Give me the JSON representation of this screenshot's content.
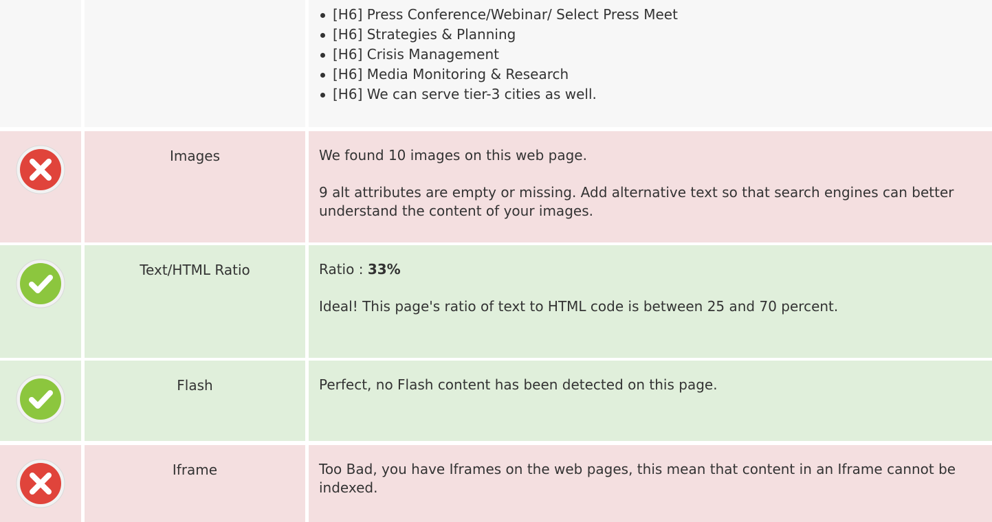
{
  "headings_row": {
    "items": [
      "[H6] Press Conference/Webinar/ Select Press Meet",
      "[H6] Strategies & Planning",
      "[H6] Crisis Management",
      "[H6] Media Monitoring & Research",
      "[H6] We can serve tier-3 cities as well."
    ]
  },
  "images": {
    "status_icon": "error-x-icon",
    "title": "Images",
    "line1": "We found 10 images on this web page.",
    "line2": "9 alt attributes are empty or missing. Add alternative text so that search engines can better understand the content of your images."
  },
  "ratio": {
    "status_icon": "check-icon",
    "title": "Text/HTML Ratio",
    "label": "Ratio : ",
    "value": "33%",
    "line2": "Ideal! This page's ratio of text to HTML code is between 25 and 70 percent."
  },
  "flash": {
    "status_icon": "check-icon",
    "title": "Flash",
    "line1": "Perfect, no Flash content has been detected on this page."
  },
  "iframe": {
    "status_icon": "error-x-icon",
    "title": "Iframe",
    "line1": "Too Bad, you have Iframes on the web pages, this mean that content in an Iframe cannot be indexed."
  },
  "colors": {
    "bad_bg": "#f4dfe0",
    "good_bg": "#e0efdb",
    "neutral_bg": "#f7f7f7",
    "error_red": "#e0443b",
    "ok_green": "#8cc63e"
  }
}
